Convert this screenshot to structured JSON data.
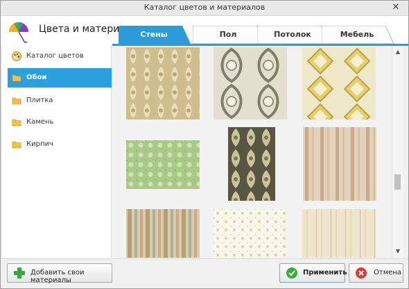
{
  "window": {
    "title": "Каталог цветов и материалов",
    "close_glyph": "✕"
  },
  "header": {
    "title": "Цвета и материалы",
    "logo_icon": "umbrella-icon"
  },
  "tabs": [
    {
      "label": "Стены",
      "active": true
    },
    {
      "label": "Пол",
      "active": false
    },
    {
      "label": "Потолок",
      "active": false
    },
    {
      "label": "Мебель",
      "active": false
    }
  ],
  "sidebar": {
    "items": [
      {
        "label": "Каталог цветов",
        "icon": "palette-icon",
        "active": false
      },
      {
        "label": "Обои",
        "icon": "folder-icon",
        "active": true
      },
      {
        "label": "Плитка",
        "icon": "folder-icon",
        "active": false
      },
      {
        "label": "Камень",
        "icon": "folder-icon",
        "active": false
      },
      {
        "label": "Кирпич",
        "icon": "folder-icon",
        "active": false
      }
    ]
  },
  "gallery": {
    "tiles": [
      {
        "pattern": "damask-gold",
        "colors": [
          "#c9b88a",
          "#e8dcb5"
        ]
      },
      {
        "pattern": "medallion-gray",
        "colors": [
          "#8e8e7a",
          "#e6e2d2"
        ]
      },
      {
        "pattern": "diamond-yellow",
        "colors": [
          "#d9c86a",
          "#f2ecc8"
        ]
      },
      {
        "pattern": "floral-green",
        "colors": [
          "#9dc07a",
          "#c9dfa8"
        ]
      },
      {
        "pattern": "damask-dark",
        "colors": [
          "#4e4a36",
          "#c9c19a"
        ]
      },
      {
        "pattern": "stripes-beige",
        "colors": [
          "#c9ab8d",
          "#e4d3bd"
        ]
      },
      {
        "pattern": "stripes-multi",
        "colors": [
          "#b9a377",
          "#ddd3b8"
        ]
      },
      {
        "pattern": "floral-cream",
        "colors": [
          "#e9e3c9",
          "#fbf9ef"
        ]
      },
      {
        "pattern": "planks-cream",
        "colors": [
          "#e7dbbf",
          "#f5eedc"
        ]
      }
    ]
  },
  "scroll": {
    "position": 0.58
  },
  "footer": {
    "add_label": "Добавить свои материалы",
    "apply_label": "Применить",
    "cancel_label": "Отмена"
  },
  "colors": {
    "accent": "#2aa0df",
    "tab_active": "#2d9bd8"
  }
}
